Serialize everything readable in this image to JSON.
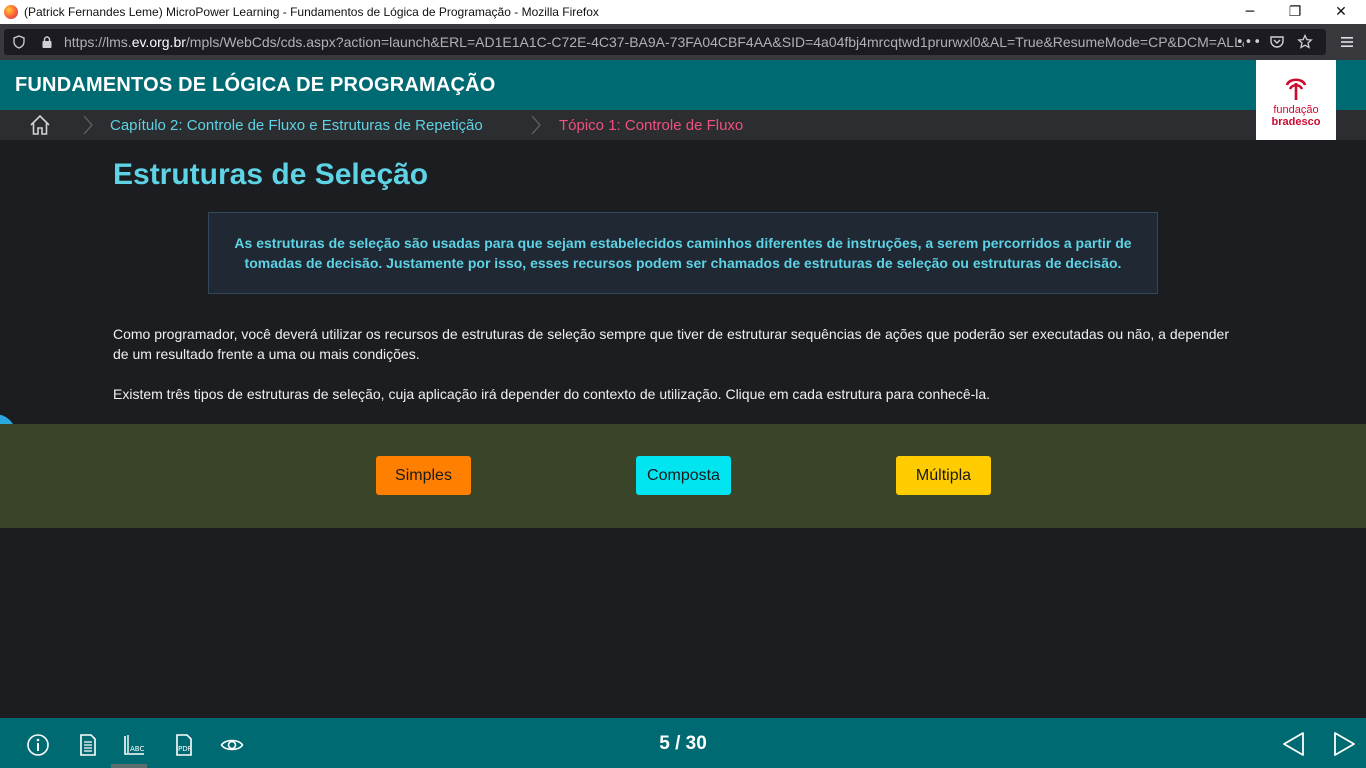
{
  "browser": {
    "window_title": "(Patrick Fernandes Leme) MicroPower Learning - Fundamentos de Lógica de Programação - Mozilla Firefox",
    "url_prefix": "https://lms.",
    "url_domain": "ev.org.br",
    "url_rest": "/mpls/WebCds/cds.aspx?action=launch&ERL=AD1E1A1C-C72E-4C37-BA9A-73FA04CBF4AA&SID=4a04fbj4mrcqtwd1prurwxl0&AL=True&ResumeMode=CP&DCM=ALL&",
    "more_label": "•••",
    "minimize": "─",
    "restore": "❐",
    "close": "✕"
  },
  "header": {
    "course_title": "FUNDAMENTOS DE LÓGICA DE PROGRAMAÇÃO",
    "logo_line1": "fundação",
    "logo_line2": "bradesco"
  },
  "breadcrumb": {
    "chapter": "Capítulo 2: Controle de Fluxo e Estruturas de Repetição",
    "topic": "Tópico 1: Controle de Fluxo"
  },
  "content": {
    "heading": "Estruturas de Seleção",
    "highlight": "As estruturas de seleção são usadas para que sejam estabelecidos caminhos diferentes de instruções, a serem percorridos a partir de tomadas de decisão. Justamente por isso, esses recursos podem ser chamados de estruturas de seleção ou estruturas de decisão.",
    "paragraph1": "Como programador, você deverá utilizar os recursos de estruturas de seleção sempre que tiver de estruturar sequências de ações que poderão ser executadas ou não, a depender de um resultado frente a uma ou mais condições.",
    "paragraph2": "Existem três tipos de estruturas de seleção, cuja aplicação irá depender do contexto de utilização. Clique em cada estrutura para conhecê-la."
  },
  "choices": [
    {
      "label": "Simples",
      "color": "#ff7f00"
    },
    {
      "label": "Composta",
      "color": "#00e5f0"
    },
    {
      "label": "Múltipla",
      "color": "#ffcc00"
    }
  ],
  "footer": {
    "page_counter": "5 / 30",
    "icons": [
      "info-icon",
      "document-icon",
      "glossary-icon",
      "pdf-icon",
      "eye-icon"
    ]
  },
  "colors": {
    "header_bg": "#006a73",
    "accent_cyan": "#5dd3e5",
    "topic_pink": "#f0507e",
    "logo_red": "#cc092f"
  }
}
